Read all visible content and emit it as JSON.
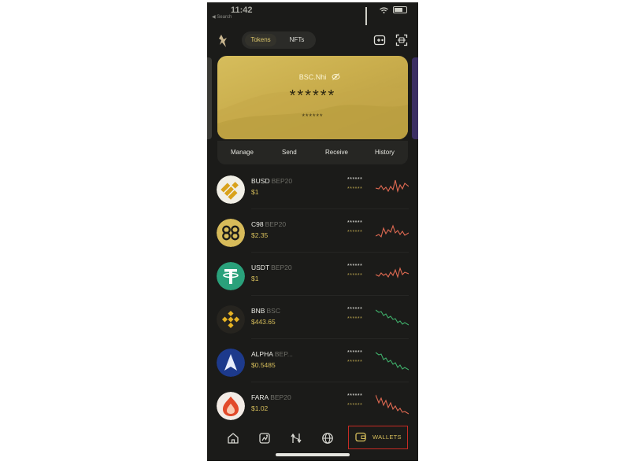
{
  "status": {
    "time": "11:42",
    "carrier": "◀ Search"
  },
  "header": {
    "tabs": [
      {
        "label": "Tokens"
      },
      {
        "label": "NFTs"
      }
    ]
  },
  "card": {
    "wallet_name": "BSC.Nhi",
    "balance_masked": "******",
    "sub_masked": "******",
    "actions": [
      {
        "label": "Manage"
      },
      {
        "label": "Send"
      },
      {
        "label": "Receive"
      },
      {
        "label": "History"
      }
    ]
  },
  "tokens": [
    {
      "symbol": "BUSD",
      "network": "BEP20",
      "price": "$1",
      "amount_masked": "******",
      "value_masked": "******",
      "trend": "red",
      "icon": "busd-icon"
    },
    {
      "symbol": "C98",
      "network": "BEP20",
      "price": "$2.35",
      "amount_masked": "******",
      "value_masked": "******",
      "trend": "red",
      "icon": "c98-icon"
    },
    {
      "symbol": "USDT",
      "network": "BEP20",
      "price": "$1",
      "amount_masked": "******",
      "value_masked": "******",
      "trend": "red",
      "icon": "usdt-icon"
    },
    {
      "symbol": "BNB",
      "network": "BSC",
      "price": "$443.65",
      "amount_masked": "******",
      "value_masked": "******",
      "trend": "green",
      "icon": "bnb-icon"
    },
    {
      "symbol": "ALPHA",
      "network": "BEP...",
      "price": "$0.5485",
      "amount_masked": "******",
      "value_masked": "******",
      "trend": "green",
      "icon": "alpha-icon"
    },
    {
      "symbol": "FARA",
      "network": "BEP20",
      "price": "$1.02",
      "amount_masked": "******",
      "value_masked": "******",
      "trend": "red",
      "icon": "fara-icon"
    }
  ],
  "nav": {
    "active_label": "WALLETS",
    "items": [
      "home-icon",
      "news-icon",
      "swap-icon",
      "browser-icon",
      "wallet-icon"
    ]
  },
  "colors": {
    "background": "#1b1b19",
    "accent_gold": "#d6be5b",
    "trend_red": "#e06a52",
    "trend_green": "#3fae6a",
    "highlight": "#c62b24"
  }
}
